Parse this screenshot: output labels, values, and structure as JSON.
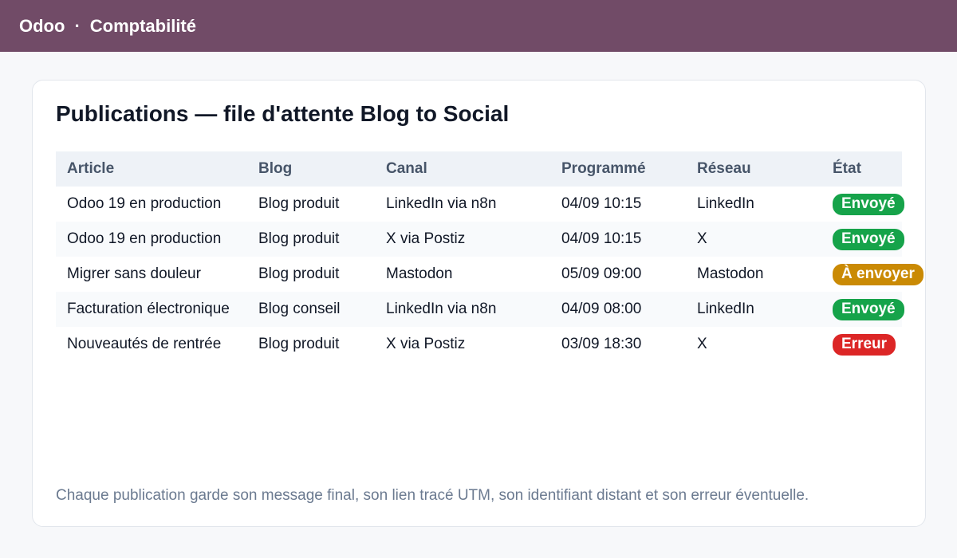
{
  "header": {
    "app": "Odoo",
    "separator": "·",
    "module": "Comptabilité"
  },
  "page": {
    "title": "Publications — file d'attente Blog to Social",
    "footnote": "Chaque publication garde son message final, son lien tracé UTM, son identifiant distant et son erreur éventuelle."
  },
  "table": {
    "columns": [
      "Article",
      "Blog",
      "Canal",
      "Programmé",
      "Réseau",
      "État"
    ],
    "rows": [
      {
        "article": "Odoo 19 en production",
        "blog": "Blog produit",
        "canal": "LinkedIn via n8n",
        "programme": "04/09 10:15",
        "reseau": "LinkedIn",
        "etat": "Envoyé",
        "etat_color": "#16a34a"
      },
      {
        "article": "Odoo 19 en production",
        "blog": "Blog produit",
        "canal": "X via Postiz",
        "programme": "04/09 10:15",
        "reseau": "X",
        "etat": "Envoyé",
        "etat_color": "#16a34a"
      },
      {
        "article": "Migrer sans douleur",
        "blog": "Blog produit",
        "canal": "Mastodon",
        "programme": "05/09 09:00",
        "reseau": "Mastodon",
        "etat": "À envoyer",
        "etat_color": "#ca8a04"
      },
      {
        "article": "Facturation électronique",
        "blog": "Blog conseil",
        "canal": "LinkedIn via n8n",
        "programme": "04/09 08:00",
        "reseau": "LinkedIn",
        "etat": "Envoyé",
        "etat_color": "#16a34a"
      },
      {
        "article": "Nouveautés de rentrée",
        "blog": "Blog produit",
        "canal": "X via Postiz",
        "programme": "03/09 18:30",
        "reseau": "X",
        "etat": "Erreur",
        "etat_color": "#dc2626"
      }
    ]
  }
}
